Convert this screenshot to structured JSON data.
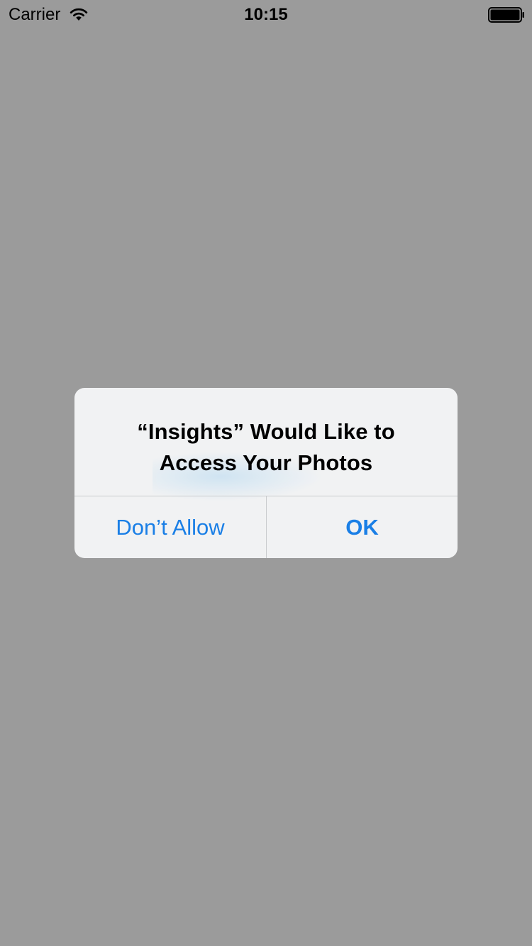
{
  "status_bar": {
    "carrier": "Carrier",
    "time": "10:15",
    "wifi_icon": "wifi-icon",
    "battery_icon": "battery-full-icon"
  },
  "alert": {
    "title_line1": "“Insights” Would Like to",
    "title_line2": "Access Your Photos",
    "buttons": {
      "dont_allow": "Don’t Allow",
      "ok": "OK"
    }
  },
  "colors": {
    "background": "#9b9b9b",
    "alert_background": "#f4f5f6",
    "accent": "#1a7fe6",
    "divider": "#c9cbcd"
  }
}
